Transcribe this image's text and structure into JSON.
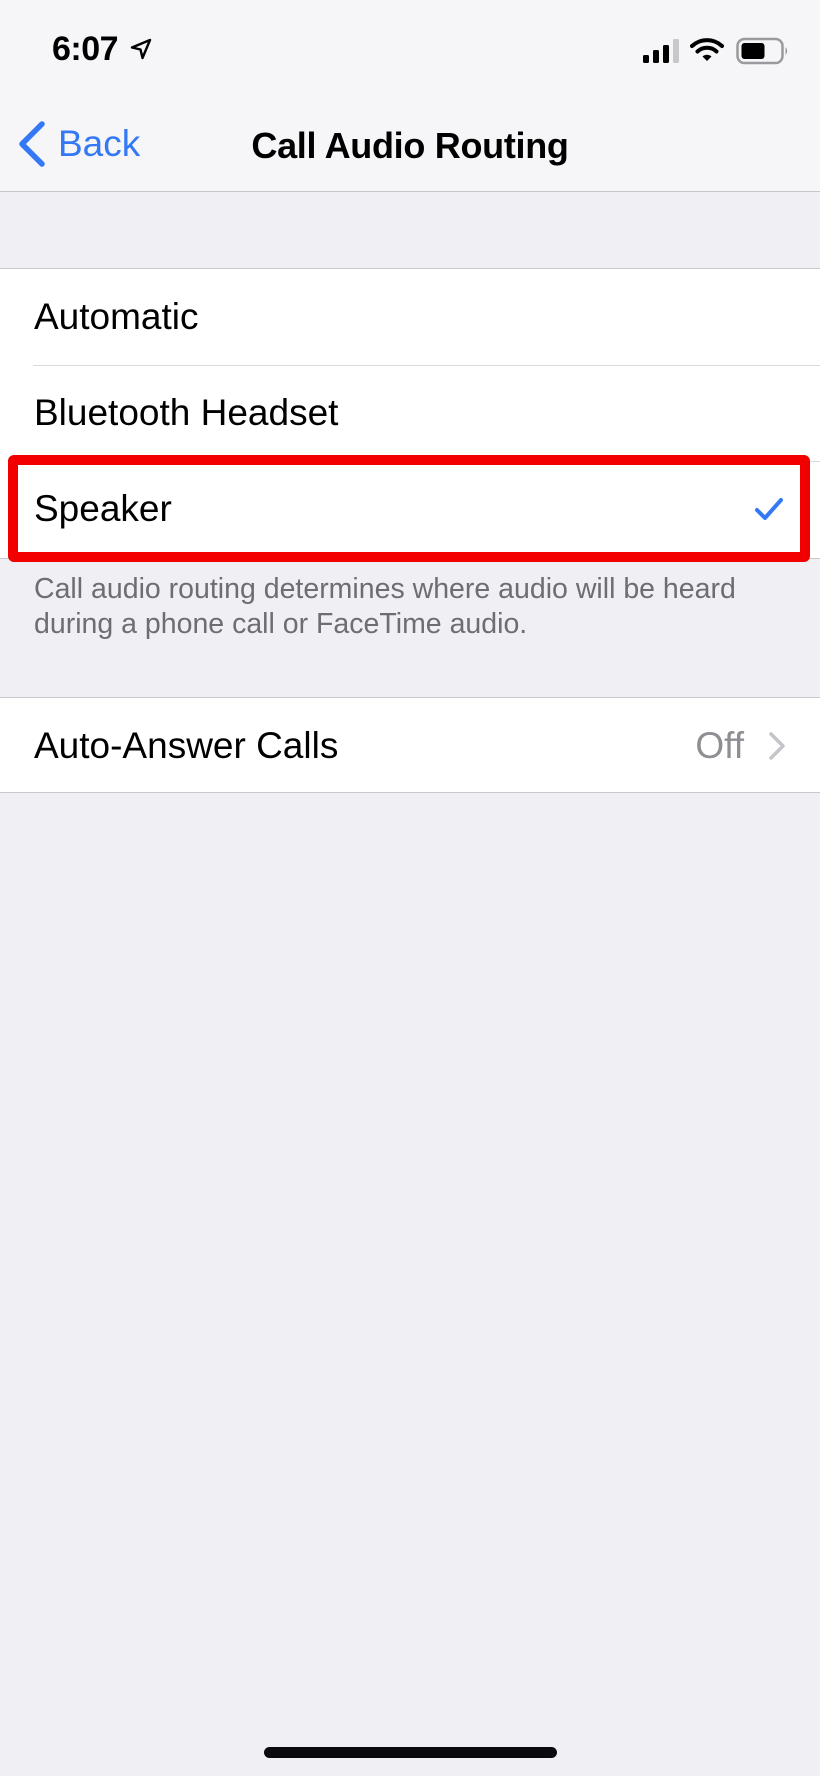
{
  "status_bar": {
    "time": "6:07",
    "icons": [
      "location-arrow-icon",
      "cellular-signal-icon",
      "wifi-icon",
      "battery-icon"
    ],
    "signal_bars_active": 3,
    "signal_bars_total": 4,
    "battery_level_fraction": 0.6
  },
  "nav": {
    "back_label": "Back",
    "title": "Call Audio Routing"
  },
  "routing": {
    "options": [
      {
        "label": "Automatic",
        "selected": false
      },
      {
        "label": "Bluetooth Headset",
        "selected": false
      },
      {
        "label": "Speaker",
        "selected": true
      }
    ],
    "footer": "Call audio routing determines where audio will be heard during a phone call or FaceTime audio."
  },
  "auto_answer": {
    "label": "Auto-Answer Calls",
    "value": "Off"
  },
  "colors": {
    "accent": "#3478f6",
    "highlight": "#f20000",
    "background": "#efeff4",
    "secondary_text": "#6d6d72",
    "value_text": "#8e8e93"
  }
}
